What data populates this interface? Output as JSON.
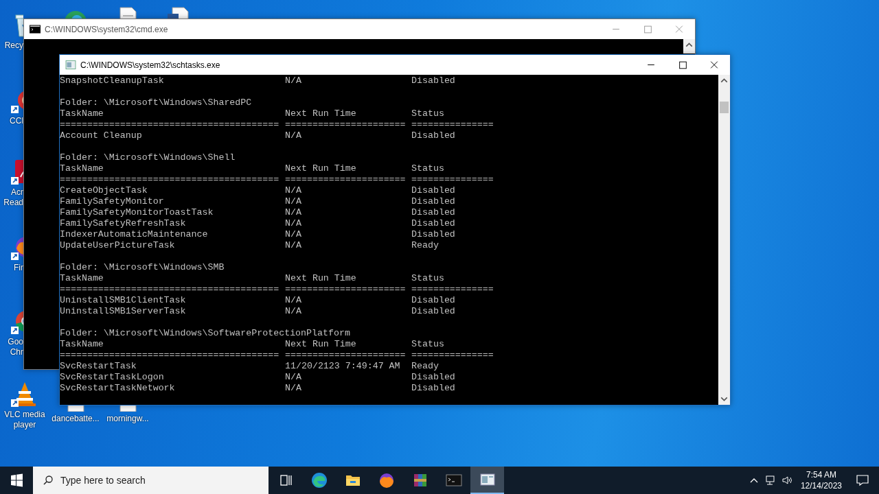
{
  "desktop": {
    "icons": [
      {
        "kind": "recycle",
        "label": "Recy"
      },
      {
        "kind": "browser"
      },
      {
        "kind": "document"
      },
      {
        "kind": "word"
      },
      {
        "kind": "cleaner",
        "label": "CCl"
      },
      {
        "kind": "reader",
        "label": "Acr Read"
      },
      {
        "kind": "firefox",
        "label": "Fir"
      },
      {
        "kind": "chrome",
        "label": "Goo Chr"
      },
      {
        "kind": "vlc",
        "label": "VLC media player"
      },
      {
        "kind": "file",
        "label": "dancebatte..."
      },
      {
        "kind": "file",
        "label": "morningw..."
      }
    ]
  },
  "windows": [
    {
      "title": "C:\\WINDOWS\\system32\\cmd.exe",
      "kind": "cmd"
    },
    {
      "title": "C:\\WINDOWS\\system32\\schtasks.exe",
      "kind": "console",
      "lines": [
        {
          "kind": "task",
          "cells": [
            "SnapshotCleanupTask",
            "N/A",
            "Disabled"
          ]
        },
        {
          "kind": "blank"
        },
        {
          "kind": "folder",
          "text": "Folder: \\Microsoft\\Windows\\SharedPC"
        },
        {
          "kind": "header",
          "cells": [
            "TaskName",
            "Next Run Time",
            "Status"
          ]
        },
        {
          "kind": "rule",
          "cells": [
            "========================================",
            "======================",
            "==============="
          ]
        },
        {
          "kind": "task",
          "cells": [
            "Account Cleanup",
            "N/A",
            "Disabled"
          ]
        },
        {
          "kind": "blank"
        },
        {
          "kind": "folder",
          "text": "Folder: \\Microsoft\\Windows\\Shell"
        },
        {
          "kind": "header",
          "cells": [
            "TaskName",
            "Next Run Time",
            "Status"
          ]
        },
        {
          "kind": "rule",
          "cells": [
            "========================================",
            "======================",
            "==============="
          ]
        },
        {
          "kind": "task",
          "cells": [
            "CreateObjectTask",
            "N/A",
            "Disabled"
          ]
        },
        {
          "kind": "task",
          "cells": [
            "FamilySafetyMonitor",
            "N/A",
            "Disabled"
          ]
        },
        {
          "kind": "task",
          "cells": [
            "FamilySafetyMonitorToastTask",
            "N/A",
            "Disabled"
          ]
        },
        {
          "kind": "task",
          "cells": [
            "FamilySafetyRefreshTask",
            "N/A",
            "Disabled"
          ]
        },
        {
          "kind": "task",
          "cells": [
            "IndexerAutomaticMaintenance",
            "N/A",
            "Disabled"
          ]
        },
        {
          "kind": "task",
          "cells": [
            "UpdateUserPictureTask",
            "N/A",
            "Ready"
          ]
        },
        {
          "kind": "blank"
        },
        {
          "kind": "folder",
          "text": "Folder: \\Microsoft\\Windows\\SMB"
        },
        {
          "kind": "header",
          "cells": [
            "TaskName",
            "Next Run Time",
            "Status"
          ]
        },
        {
          "kind": "rule",
          "cells": [
            "========================================",
            "======================",
            "==============="
          ]
        },
        {
          "kind": "task",
          "cells": [
            "UninstallSMB1ClientTask",
            "N/A",
            "Disabled"
          ]
        },
        {
          "kind": "task",
          "cells": [
            "UninstallSMB1ServerTask",
            "N/A",
            "Disabled"
          ]
        },
        {
          "kind": "blank"
        },
        {
          "kind": "folder",
          "text": "Folder: \\Microsoft\\Windows\\SoftwareProtectionPlatform"
        },
        {
          "kind": "header",
          "cells": [
            "TaskName",
            "Next Run Time",
            "Status"
          ]
        },
        {
          "kind": "rule",
          "cells": [
            "========================================",
            "======================",
            "==============="
          ]
        },
        {
          "kind": "task",
          "cells": [
            "SvcRestartTask",
            "11/20/2123 7:49:47 AM",
            "Ready"
          ]
        },
        {
          "kind": "task",
          "cells": [
            "SvcRestartTaskLogon",
            "N/A",
            "Disabled"
          ]
        },
        {
          "kind": "task",
          "cells": [
            "SvcRestartTaskNetwork",
            "N/A",
            "Disabled"
          ]
        }
      ]
    }
  ],
  "taskbar": {
    "search": {
      "placeholder": "Type here to search"
    },
    "apps": [
      {
        "kind": "taskview",
        "selected": false
      },
      {
        "kind": "edge",
        "selected": false
      },
      {
        "kind": "explorer",
        "selected": false
      },
      {
        "kind": "firefox",
        "selected": false
      },
      {
        "kind": "archiver",
        "selected": false
      },
      {
        "kind": "cmd",
        "selected": false
      },
      {
        "kind": "console",
        "selected": true
      }
    ],
    "clock": {
      "time": "7:54 AM",
      "date": "12/14/2023"
    }
  }
}
